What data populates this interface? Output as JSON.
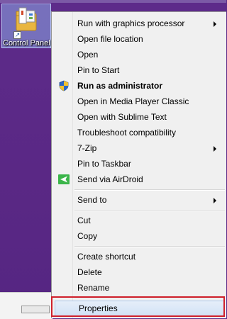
{
  "desktop": {
    "icon_label": "Control Panel",
    "icon_name": "control-panel-icon",
    "shortcut_icon": "shortcut-arrow-icon"
  },
  "context_menu": {
    "items": [
      {
        "label": "Run with graphics processor",
        "submenu": true
      },
      {
        "label": "Open file location"
      },
      {
        "label": "Open"
      },
      {
        "label": "Pin to Start"
      },
      {
        "label": "Run as administrator",
        "bold": true,
        "icon": "uac-shield-icon"
      },
      {
        "label": "Open in Media Player Classic"
      },
      {
        "label": "Open with Sublime Text"
      },
      {
        "label": "Troubleshoot compatibility"
      },
      {
        "label": "7-Zip",
        "submenu": true
      },
      {
        "label": "Pin to Taskbar"
      },
      {
        "label": "Send via AirDroid",
        "icon": "airdroid-icon"
      },
      {
        "label": "Send to",
        "submenu": true
      },
      {
        "label": "Cut"
      },
      {
        "label": "Copy"
      },
      {
        "label": "Create shortcut"
      },
      {
        "label": "Delete"
      },
      {
        "label": "Rename"
      },
      {
        "label": "Properties",
        "highlighted": true
      }
    ]
  },
  "colors": {
    "desktop_bg": "#5a2885",
    "menu_bg": "#f0f0f0",
    "highlight_border": "#a8c5ec",
    "annotation_red": "#d0202b",
    "airdroid_green": "#3bb54a"
  }
}
